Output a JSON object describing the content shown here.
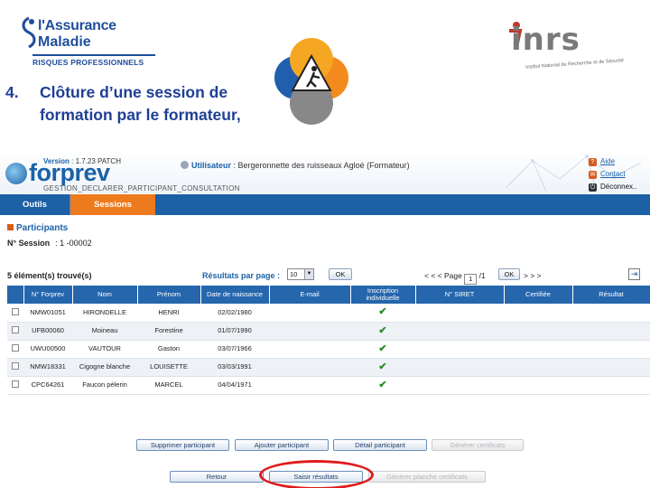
{
  "slide": {
    "logo_left": {
      "line1": "l'Assurance",
      "line2": "Maladie",
      "line3": "RISQUES PROFESSIONNELS"
    },
    "logo_right": {
      "word": "inrs",
      "tagline": "Institut National de Recherche et de Sécurité"
    },
    "title_number": "4.",
    "title_line1": "Clôture d’une session de",
    "title_line2": "formation par le formateur,"
  },
  "app": {
    "brand": "forprev",
    "version_label": "Version",
    "version_value": ": 1.7.23 PATCH",
    "screen_code": "GESTION_DECLARER_PARTICIPANT_CONSULTATION",
    "user_label": "Utilisateur",
    "user_value": ": Bergeronnette des ruisseaux Agloé (Formateur)",
    "links": {
      "help": "Aide",
      "contact": "Contact",
      "logout": "Déconnex.."
    },
    "tabs": [
      {
        "label": "Outils"
      },
      {
        "label": "Sessions"
      }
    ],
    "section_title": "Participants",
    "session_label": "N° Session",
    "session_value": ": 1 -00002",
    "count_text": "5 élément(s) trouvé(s)",
    "per_page_label": "Résultats par page :",
    "per_page_value": "10",
    "ok_label": "OK",
    "pager": {
      "prev": "< < < Page",
      "page": "1",
      "total": "/1",
      "next": "> > >"
    },
    "columns": [
      "",
      "N° Forprev",
      "Nom",
      "Prénom",
      "Date de naissance",
      "E-mail",
      "Inscription individuelle",
      "N° SIRET",
      "Certifiée",
      "Résultat"
    ],
    "rows": [
      {
        "forprev": "NMW01051",
        "nom": "HIRONDELLE",
        "prenom": "HENRI",
        "naissance": "02/02/1980",
        "inscription": "✔"
      },
      {
        "forprev": "UFB00060",
        "nom": "Moineau",
        "prenom": "Forestine",
        "naissance": "01/07/1990",
        "inscription": "✔"
      },
      {
        "forprev": "UWU00500",
        "nom": "VAUTOUR",
        "prenom": "Gaston",
        "naissance": "03/07/1966",
        "inscription": "✔"
      },
      {
        "forprev": "NMW18331",
        "nom": "Cigogne blanche",
        "prenom": "LOUISETTE",
        "naissance": "03/03/1991",
        "inscription": "✔"
      },
      {
        "forprev": "CPC64261",
        "nom": "Faucon pèlerin",
        "prenom": "MARCEL",
        "naissance": "04/04/1971",
        "inscription": "✔"
      }
    ],
    "buttons_row1": {
      "delete": "Supprimer participant",
      "add": "Ajouter participant",
      "detail": "Détail participant",
      "generate_certs": "Générer certificats"
    },
    "buttons_row2": {
      "back": "Retour",
      "enter_results": "Saisir résultats",
      "generate_sheet": "Générer planche certificats"
    }
  },
  "colors": {
    "header_blue": "#1c60a6",
    "active_tab": "#ee7a1e",
    "title_blue": "#1f3f96",
    "highlight": "#e01b1b"
  }
}
